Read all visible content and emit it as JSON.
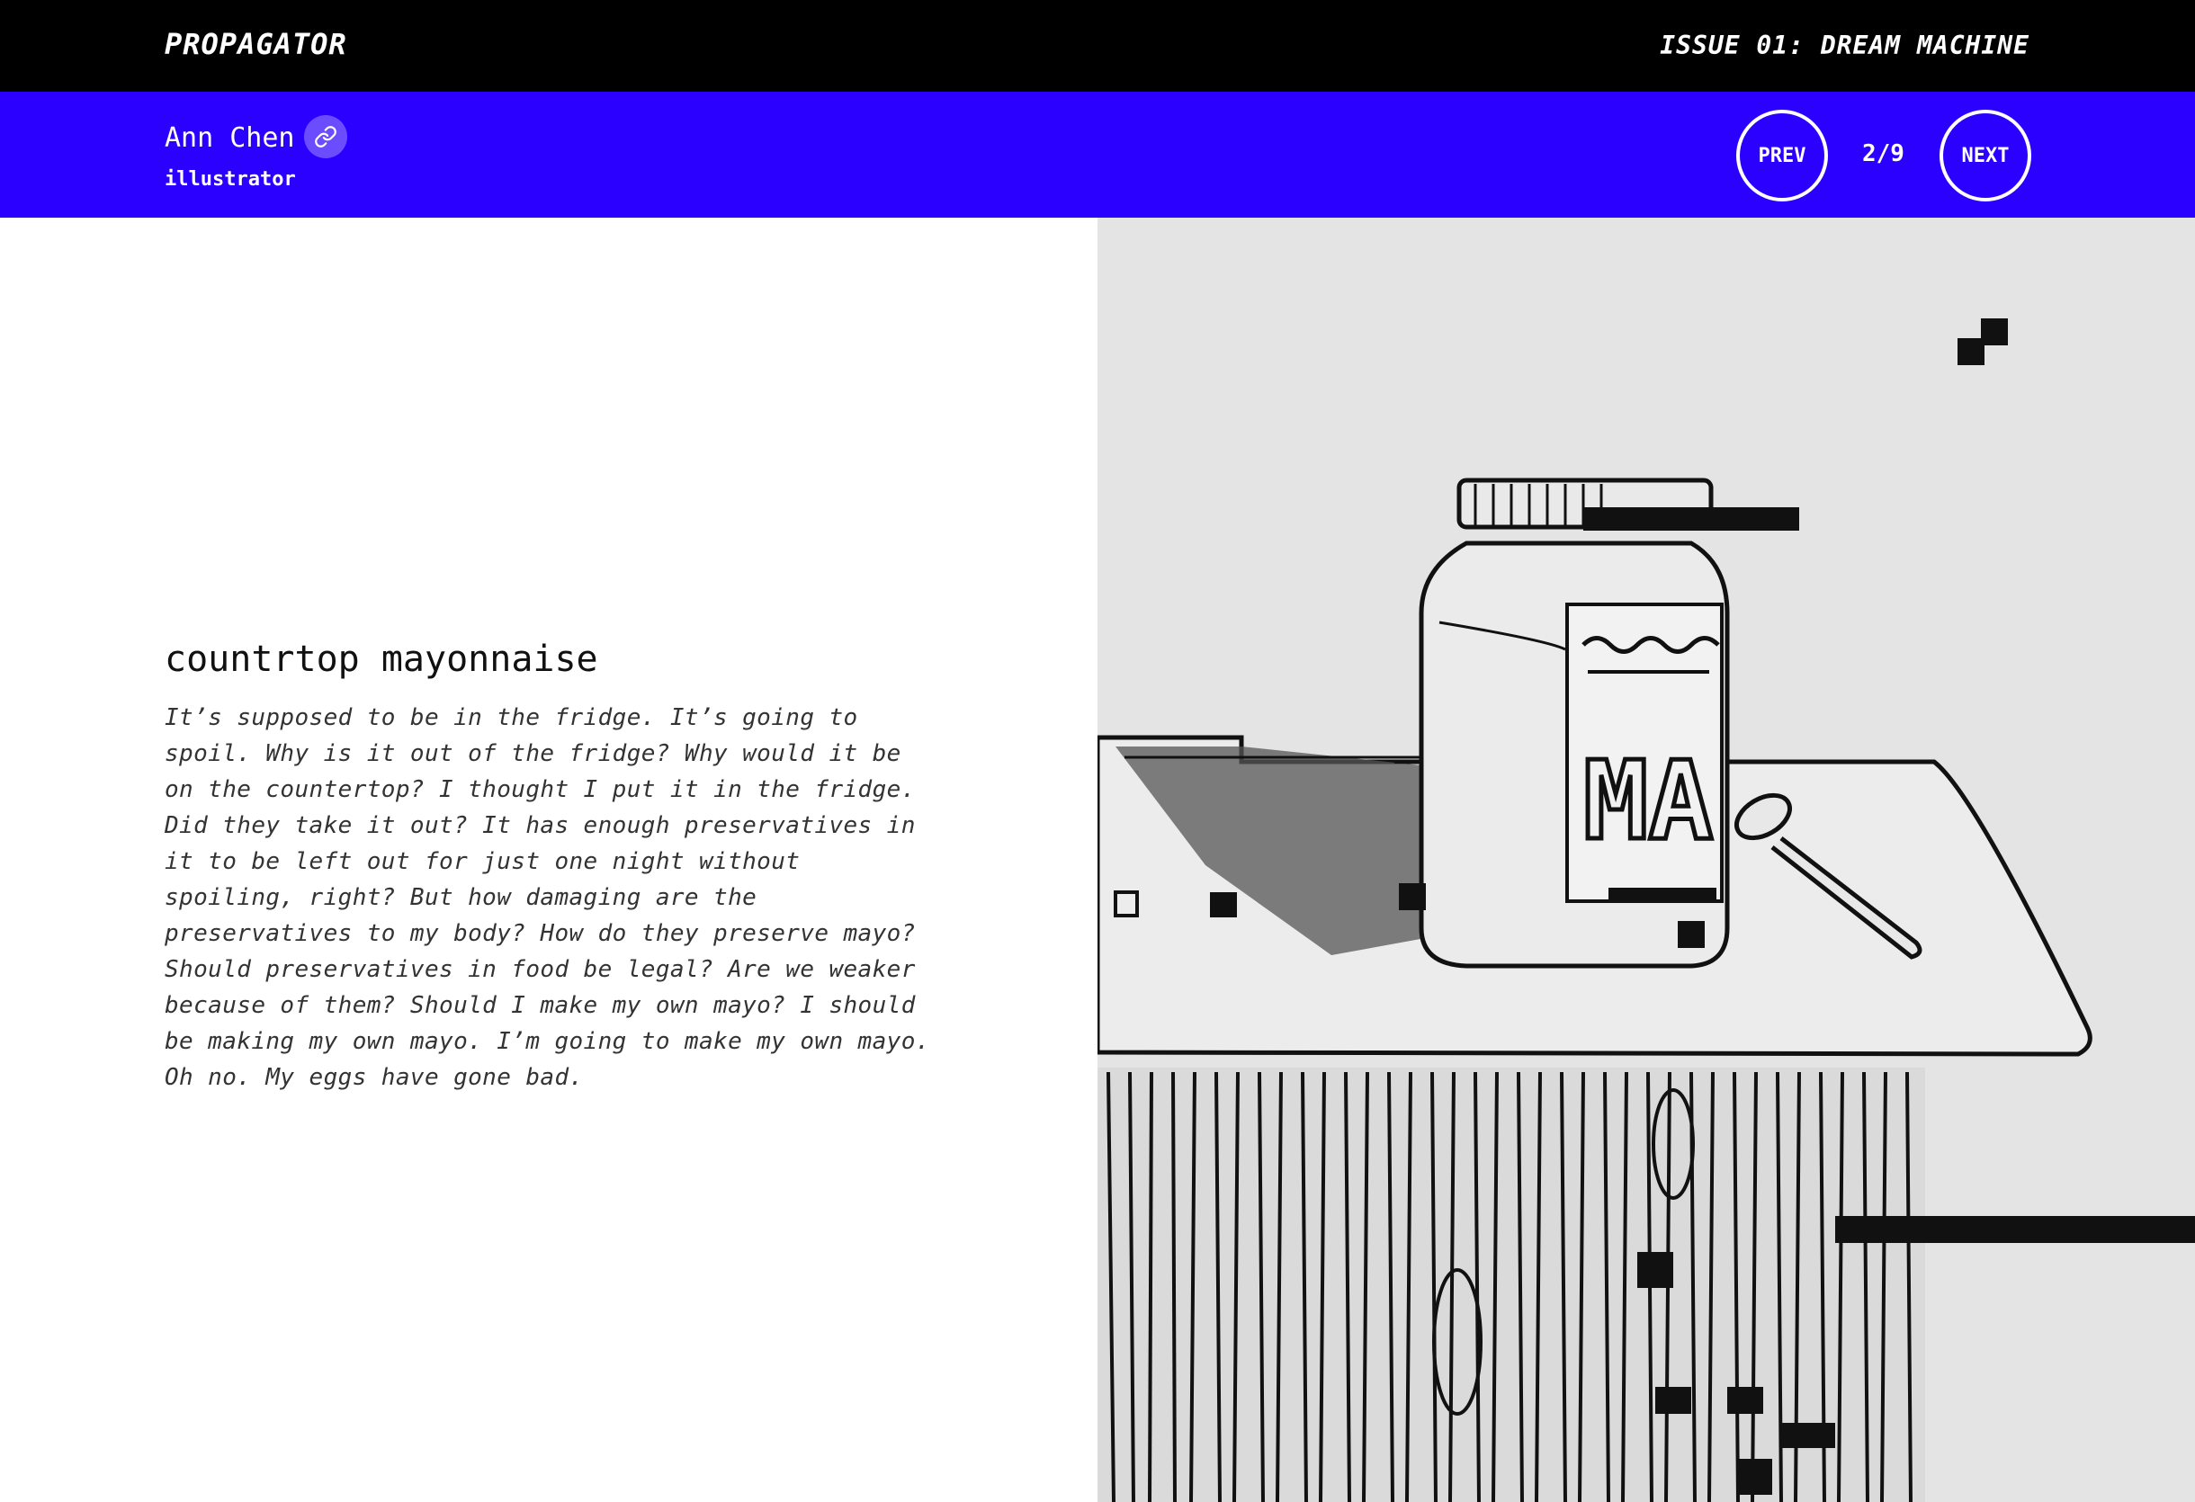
{
  "header": {
    "brand": "PROPAGATOR",
    "issue": "ISSUE 01: DREAM MACHINE"
  },
  "author": {
    "name": "Ann Chen",
    "role": "illustrator",
    "link_icon": "link-icon"
  },
  "pagination": {
    "prev_label": "PREV",
    "counter": "2/9",
    "next_label": "NEXT"
  },
  "piece": {
    "title": "countrtop mayonnaise",
    "body": "It’s supposed to be in the fridge. It’s going to spoil. Why is it out of the fridge? Why would it be on the countertop? I thought I put it in the fridge. Did they take it out? It has enough preservatives in it to be left out for just one night without spoiling, right? But how damaging are the preservatives to my body? How do they preserve mayo? Should preservatives in food be legal? Are we weaker because of them? Should I make my own mayo? I should be making my own mayo. I’m going to make my own mayo. Oh no. My eggs have gone bad."
  },
  "colors": {
    "topbar": "#000000",
    "bluebar": "#2c00ff",
    "text": "#333333"
  }
}
